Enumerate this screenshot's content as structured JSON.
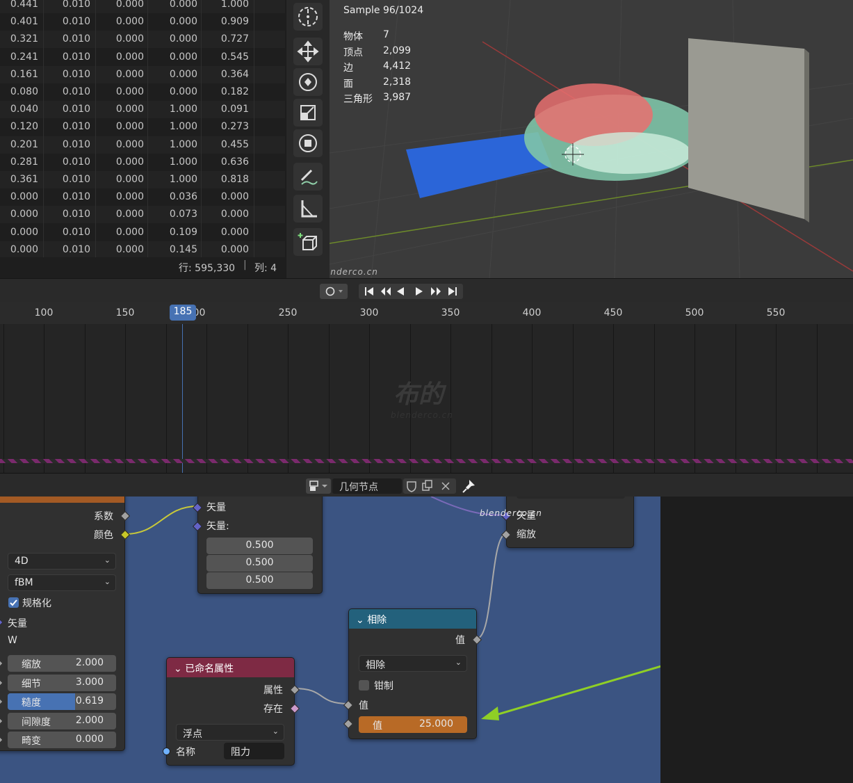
{
  "spreadsheet": {
    "rows": [
      [
        "0.441",
        "0.010",
        "0.000",
        "0.000",
        "1.000"
      ],
      [
        "0.401",
        "0.010",
        "0.000",
        "0.000",
        "0.909"
      ],
      [
        "0.321",
        "0.010",
        "0.000",
        "0.000",
        "0.727"
      ],
      [
        "0.241",
        "0.010",
        "0.000",
        "0.000",
        "0.545"
      ],
      [
        "0.161",
        "0.010",
        "0.000",
        "0.000",
        "0.364"
      ],
      [
        "0.080",
        "0.010",
        "0.000",
        "0.000",
        "0.182"
      ],
      [
        "0.040",
        "0.010",
        "0.000",
        "1.000",
        "0.091"
      ],
      [
        "0.120",
        "0.010",
        "0.000",
        "1.000",
        "0.273"
      ],
      [
        "0.201",
        "0.010",
        "0.000",
        "1.000",
        "0.455"
      ],
      [
        "0.281",
        "0.010",
        "0.000",
        "1.000",
        "0.636"
      ],
      [
        "0.361",
        "0.010",
        "0.000",
        "1.000",
        "0.818"
      ],
      [
        "0.000",
        "0.010",
        "0.000",
        "0.036",
        "0.000"
      ],
      [
        "0.000",
        "0.010",
        "0.000",
        "0.073",
        "0.000"
      ],
      [
        "0.000",
        "0.010",
        "0.000",
        "0.109",
        "0.000"
      ],
      [
        "0.000",
        "0.010",
        "0.000",
        "0.145",
        "0.000"
      ]
    ],
    "rows_label": "行: 595,330",
    "cols_label": "列: 4"
  },
  "viewport": {
    "sample": "Sample 96/1024",
    "stats": [
      {
        "label": "物体",
        "value": "7"
      },
      {
        "label": "顶点",
        "value": "2,099"
      },
      {
        "label": "边",
        "value": "4,412"
      },
      {
        "label": "面",
        "value": "2,318"
      },
      {
        "label": "三角形",
        "value": "3,987"
      }
    ],
    "watermark": "blenderco.cn"
  },
  "timeline": {
    "current_frame": "185",
    "ruler_labels": [
      "100",
      "150",
      "200",
      "250",
      "300",
      "350",
      "400",
      "450",
      "500",
      "550"
    ],
    "watermark_text": "布的",
    "watermark_url": "blenderco.cn"
  },
  "node_editor": {
    "tree_name": "几何节点",
    "noise_node": {
      "out_factor": "系数",
      "out_color": "颜色",
      "dimension": "4D",
      "type": "fBM",
      "normalize": "规格化",
      "in_vector": "矢量",
      "in_w": "W",
      "fields": [
        {
          "label": "缩放",
          "value": "2.000"
        },
        {
          "label": "细节",
          "value": "3.000"
        },
        {
          "label": "糙度",
          "value": "0.619",
          "fill": 0.619
        },
        {
          "label": "间隙度",
          "value": "2.000"
        },
        {
          "label": "畸变",
          "value": "0.000"
        }
      ]
    },
    "vector_node": {
      "in_vector": "矢量",
      "vector_label": "矢量:",
      "values": [
        "0.500",
        "0.500",
        "0.500"
      ]
    },
    "scale_node": {
      "in_vector": "矢量",
      "in_scale": "缩放"
    },
    "divide_node": {
      "title": "相除",
      "out_value": "值",
      "operation": "相除",
      "clamp": "钳制",
      "in_value1": "值",
      "in_value2_label": "值",
      "in_value2": "25.000"
    },
    "attr_node": {
      "title": "已命名属性",
      "out_attribute": "属性",
      "out_exists": "存在",
      "data_type": "浮点",
      "name_label": "名称",
      "name_value": "阻力"
    }
  },
  "colors": {
    "node_canvas": "#3b5482",
    "divide_header": "#23617c",
    "attr_header": "#7e2a44",
    "accent_blue": "#4772b3",
    "value_orange": "#b86a26",
    "arrow_green": "#8fcf26"
  }
}
